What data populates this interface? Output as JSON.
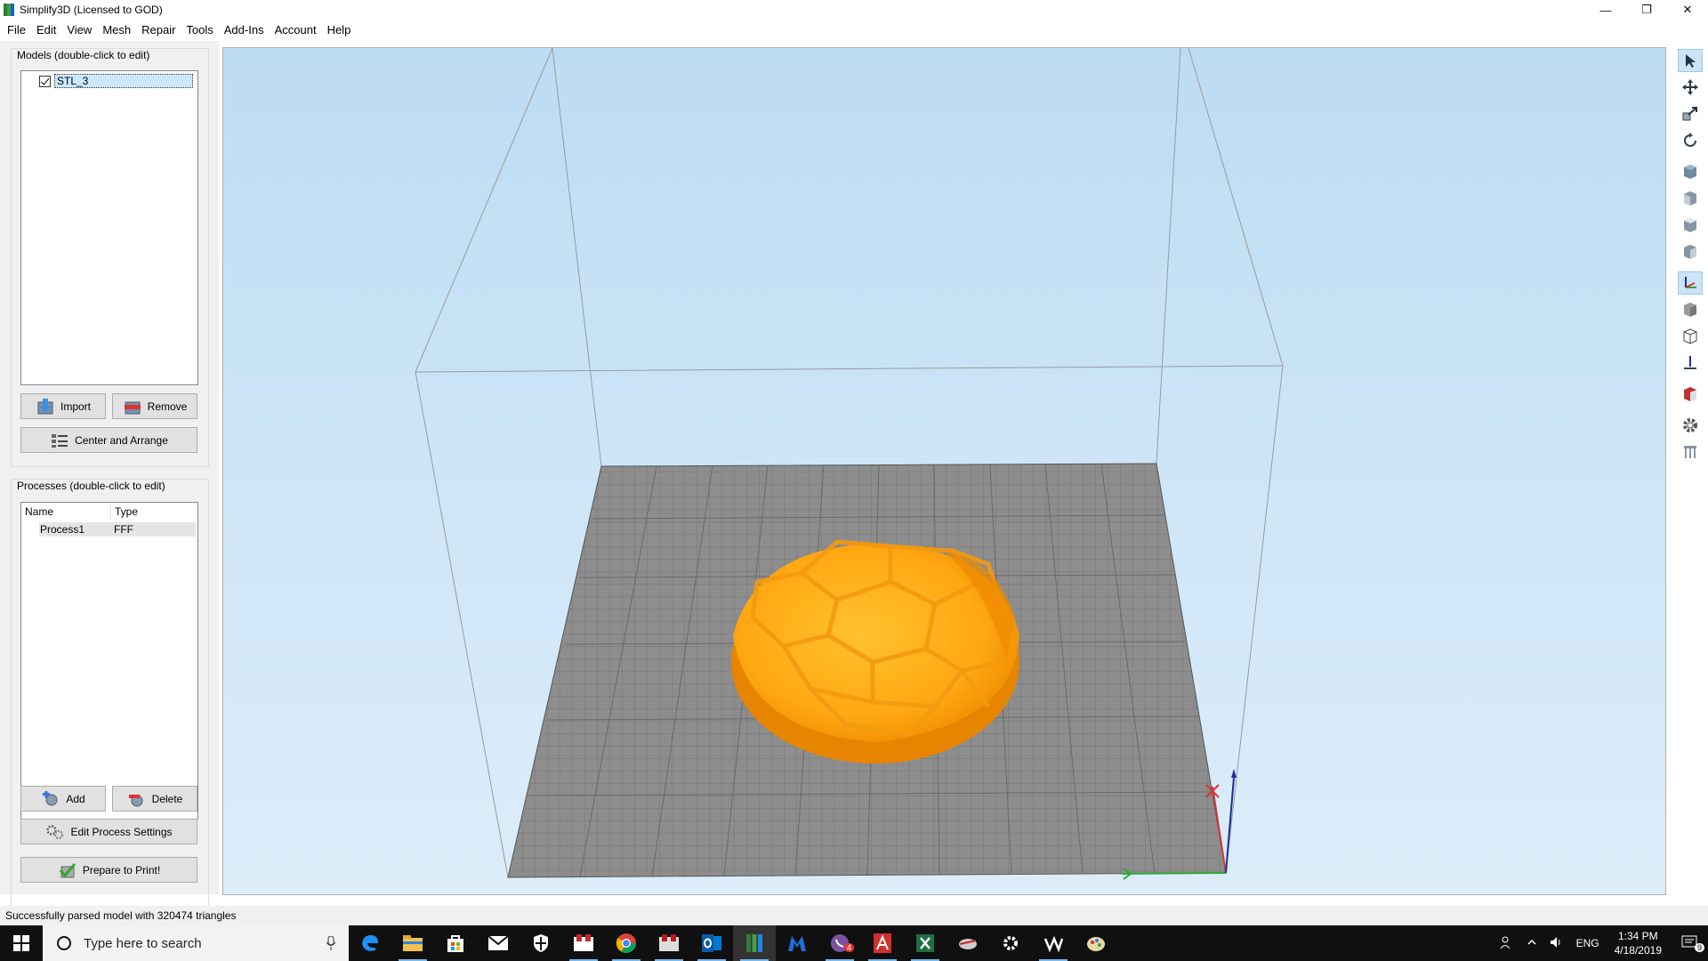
{
  "window": {
    "title": "Simplify3D (Licensed to GOD)",
    "controls": {
      "minimize": "—",
      "restore": "❐",
      "close": "✕"
    }
  },
  "menu": [
    "File",
    "Edit",
    "View",
    "Mesh",
    "Repair",
    "Tools",
    "Add-Ins",
    "Account",
    "Help"
  ],
  "models_panel": {
    "label": "Models (double-click to edit)",
    "items": [
      {
        "name": "STL_3",
        "checked": true
      }
    ],
    "import_label": "Import",
    "remove_label": "Remove",
    "center_label": "Center and Arrange"
  },
  "processes_panel": {
    "label": "Processes (double-click to edit)",
    "columns": [
      "Name",
      "Type"
    ],
    "rows": [
      {
        "name": "Process1",
        "type": "FFF"
      }
    ],
    "add_label": "Add",
    "delete_label": "Delete",
    "edit_label": "Edit Process Settings",
    "prepare_label": "Prepare to Print!"
  },
  "right_toolbar": [
    "select-cursor-icon",
    "move-icon",
    "scale-icon",
    "rotate-icon",
    "view-default-icon",
    "view-front-icon",
    "view-top-icon",
    "view-side-icon",
    "axes-icon",
    "solid-cube-icon",
    "wireframe-cube-icon",
    "build-plate-icon",
    "section-view-icon",
    "settings-gear-icon",
    "supports-icon"
  ],
  "status": "Successfully parsed model with 320474 triangles",
  "taskbar": {
    "search_placeholder": "Type here to search",
    "apps": [
      "edge",
      "file-explorer",
      "store",
      "mail",
      "security",
      "app-red",
      "chrome",
      "app-tools",
      "outlook",
      "simplify3d",
      "malwarebytes",
      "viber",
      "acrobat",
      "excel",
      "app-plane",
      "settings",
      "app-badge",
      "paint"
    ],
    "viber_badge": "4",
    "tray_language": "ENG",
    "time": "1:34 PM",
    "date": "4/18/2019",
    "notification_count": "9"
  },
  "colors": {
    "model_orange": "#ffa812",
    "model_dark": "#f08c00",
    "bed_gray": "#8a8a8a",
    "sky_top": "#bcdcf3",
    "sky_bottom": "#dcedf9"
  }
}
